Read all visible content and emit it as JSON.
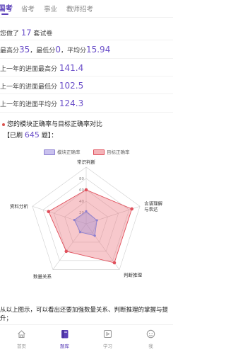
{
  "tabs": [
    {
      "label": "国考",
      "active": true
    },
    {
      "label": "省考",
      "active": false
    },
    {
      "label": "事业",
      "active": false
    },
    {
      "label": "教师招考",
      "active": false
    }
  ],
  "stats": {
    "done_prefix": "您做了",
    "done_count": "17",
    "done_suffix": "套试卷",
    "highest_label": "最高分",
    "highest": "35",
    "lowest_label": "，最低分",
    "lowest": "0",
    "average_label": "，平均分",
    "average": "15.94",
    "last_year_highest_label": "上一年的进面最高分",
    "last_year_highest": "141.4",
    "last_year_lowest_label": "上一年的进面最低分",
    "last_year_lowest": "102.5",
    "last_year_average_label": "上一年的进面平均分",
    "last_year_average": "124.3"
  },
  "section": {
    "title": "您的模块正确率与目标正确率对比",
    "count_prefix": "【已刷 ",
    "count": "645",
    "count_suffix": " 题】："
  },
  "chart_data": {
    "type": "radar",
    "axes": [
      "常识判断",
      "言语理解与表达",
      "判断推理",
      "数量关系",
      "资料分析"
    ],
    "ticks": [
      20,
      40,
      60,
      80
    ],
    "max": 100,
    "series": [
      {
        "name": "模块正确率",
        "values": [
          22,
          20,
          26,
          18,
          22
        ],
        "color": "#8c7fd1"
      },
      {
        "name": "目标正确率",
        "values": [
          60,
          85,
          85,
          60,
          70
        ],
        "color": "#e0505c"
      }
    ]
  },
  "conclusion": "从以上图示，可以看出还要加强数量关系、判断推理的掌握与提升；",
  "bottom_nav": [
    {
      "label": "首页",
      "icon": "home-icon",
      "active": false
    },
    {
      "label": "题库",
      "icon": "question-bank-icon",
      "active": true
    },
    {
      "label": "学习",
      "icon": "study-icon",
      "active": false
    },
    {
      "label": "我",
      "icon": "profile-icon",
      "active": false
    }
  ],
  "colors": {
    "accent": "#5a3fb8",
    "value": "#6b4fc9",
    "module": "#8c7fd1",
    "target": "#e0505c"
  }
}
